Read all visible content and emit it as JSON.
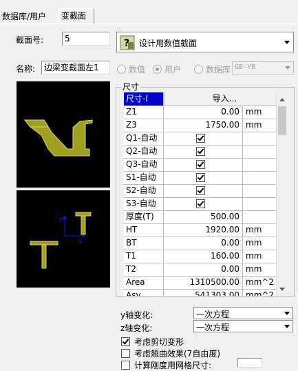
{
  "tabs": [
    {
      "label": "数据库/用户"
    },
    {
      "label": "变截面"
    }
  ],
  "section_number": {
    "label": "截面号:",
    "value": "5"
  },
  "section_type": {
    "label": "设计用数值截面",
    "icon": "design-section-icon"
  },
  "name": {
    "label": "名称:",
    "value": "边梁变截面左1"
  },
  "source": {
    "options": [
      "数值",
      "用户",
      "数据库"
    ],
    "selected": "用户",
    "db_value": "GB-YB"
  },
  "dims": {
    "group_title": "尺寸",
    "header_name": "尺寸-I",
    "header_import": "导入...",
    "rows": [
      {
        "name": "Z1",
        "value": "0.00",
        "unit": "mm"
      },
      {
        "name": "Z3",
        "value": "1750.00",
        "unit": "mm"
      },
      {
        "name": "Q1-自动",
        "checked": true
      },
      {
        "name": "Q2-自动",
        "checked": true
      },
      {
        "name": "Q3-自动",
        "checked": true
      },
      {
        "name": "S1-自动",
        "checked": true
      },
      {
        "name": "S2-自动",
        "checked": true
      },
      {
        "name": "S3-自动",
        "checked": true
      },
      {
        "name": "厚度(T)",
        "value": "500.00",
        "unit": ""
      },
      {
        "name": "HT",
        "value": "1920.00",
        "unit": "mm"
      },
      {
        "name": "BT",
        "value": "0.00",
        "unit": "mm"
      },
      {
        "name": "T1",
        "value": "160.00",
        "unit": "mm"
      },
      {
        "name": "T2",
        "value": "0.00",
        "unit": "mm"
      },
      {
        "name": "Area",
        "value": "1310500.00",
        "unit": "mm^2"
      },
      {
        "name": "Asy",
        "value": "541303.00",
        "unit": "mm^2"
      }
    ]
  },
  "y_variation": {
    "label": "y轴变化:",
    "value": "一次方程"
  },
  "z_variation": {
    "label": "z轴变化:",
    "value": "一次方程"
  },
  "options": [
    {
      "label": "考虑剪切变形",
      "checked": true
    },
    {
      "label": "考虑翘曲效果(7自由度)",
      "checked": false
    },
    {
      "label": "计算刚度用网格尺寸:",
      "checked": false
    }
  ],
  "colors": {
    "section_fill": "#a0a020",
    "axis": "#1010ff",
    "header_select": "#0000c8"
  }
}
